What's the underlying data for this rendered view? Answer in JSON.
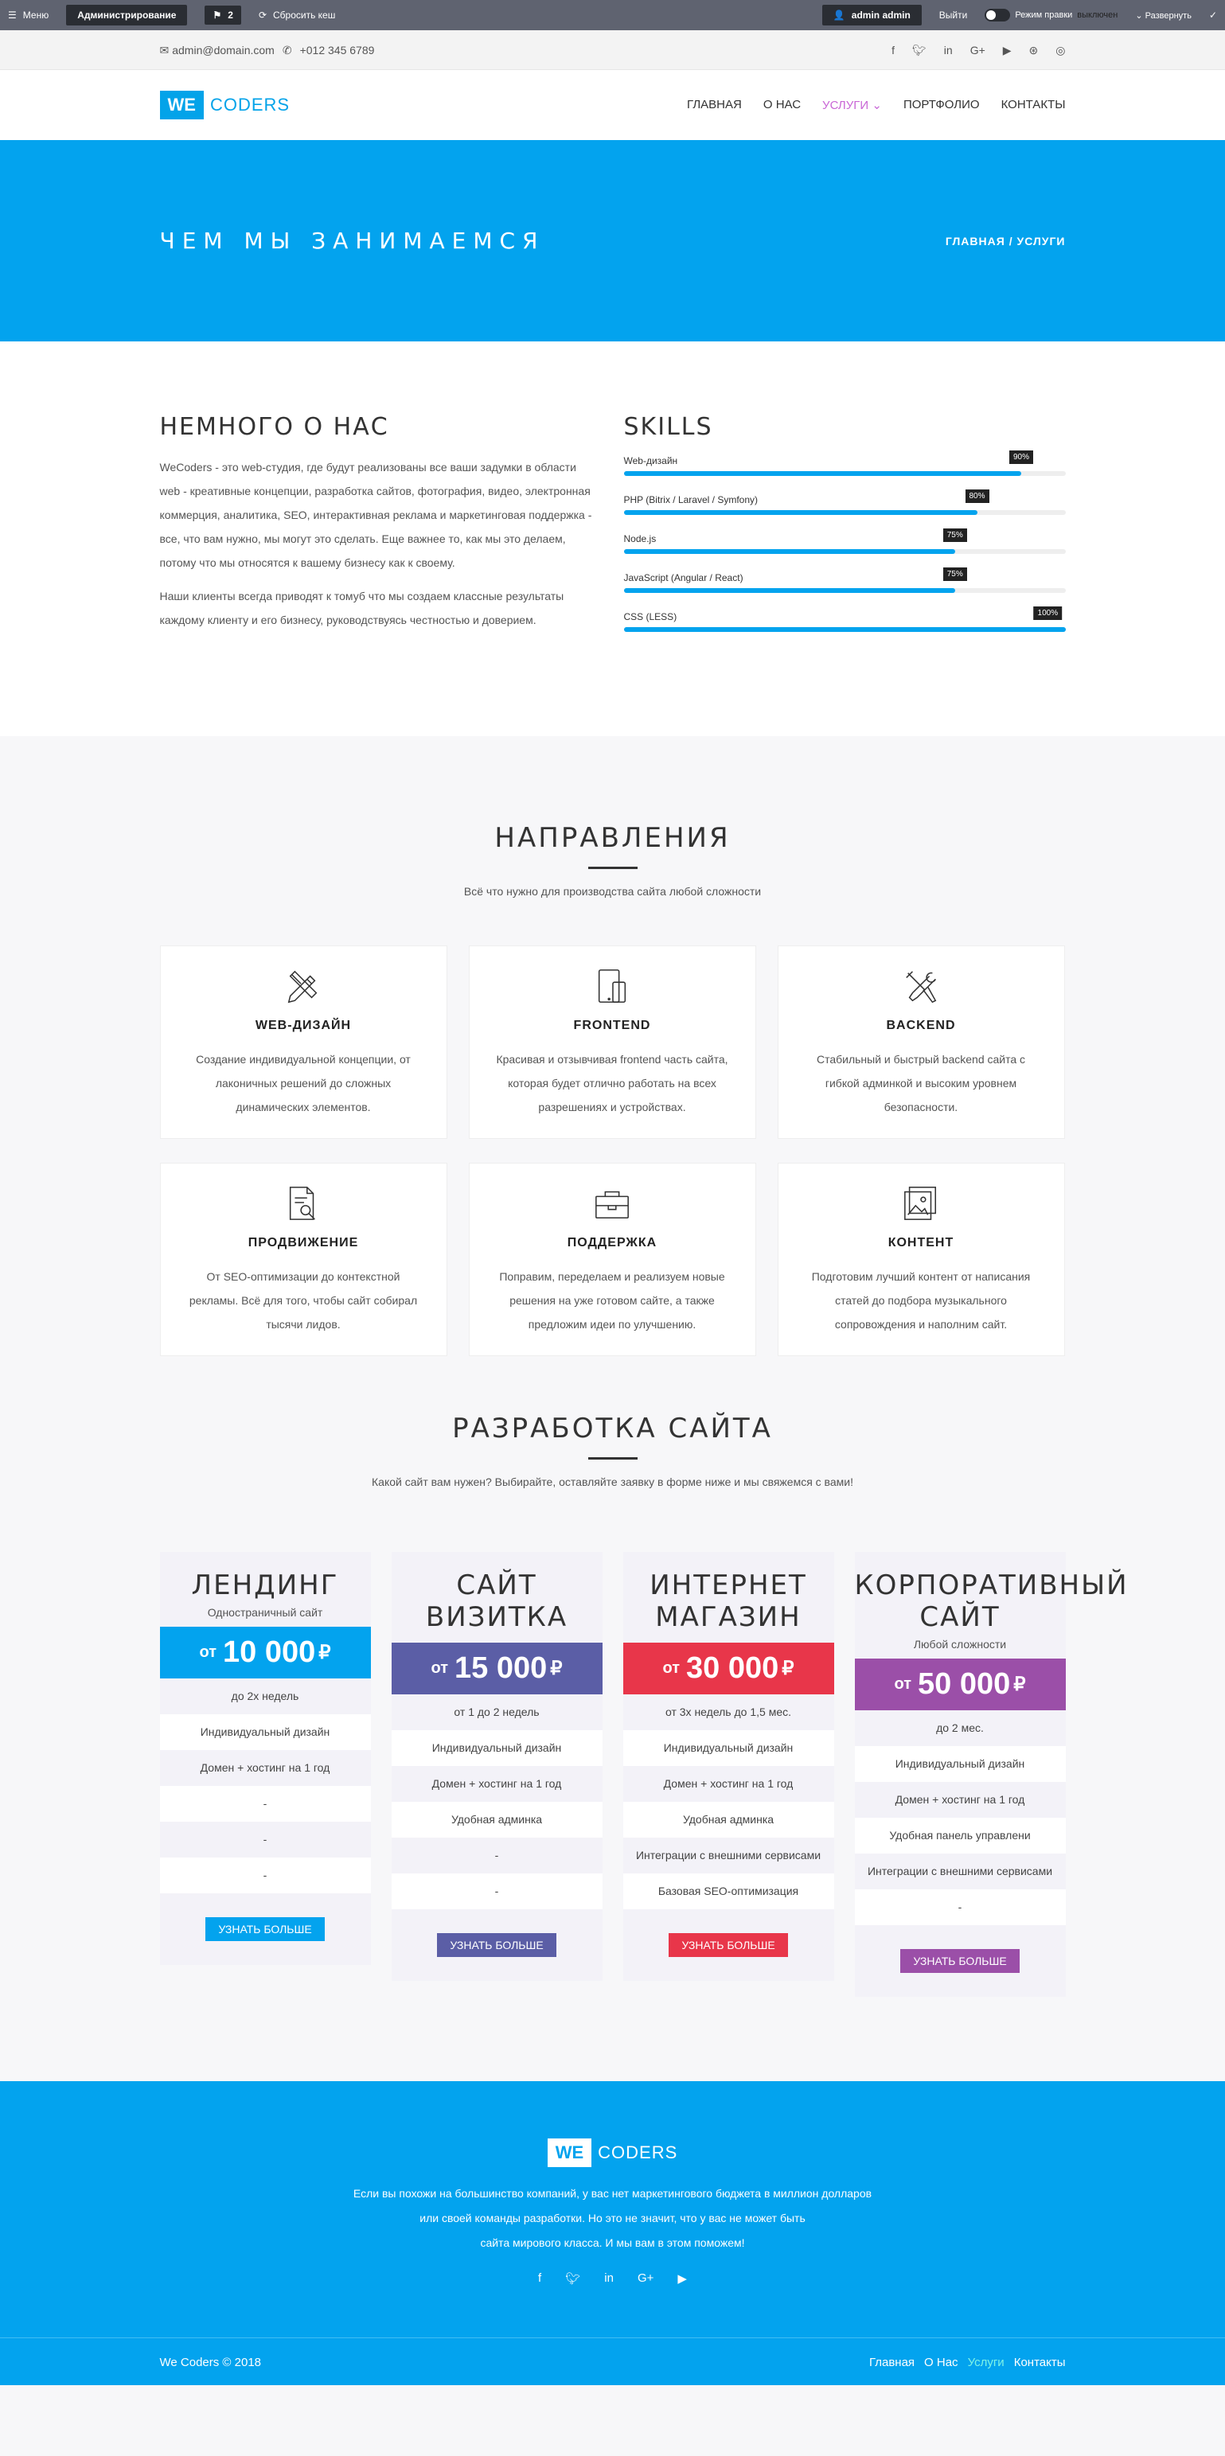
{
  "adminbar": {
    "menu": "Меню",
    "admin": "Администрирование",
    "count": "2",
    "reset": "Сбросить кеш",
    "user": "admin admin",
    "logout": "Выйти",
    "edit_mode": "Режим правки",
    "edit_state": "выключен",
    "expand": "Развернуть"
  },
  "topbar": {
    "email": "admin@domain.com",
    "phone": "+012 345 6789"
  },
  "logo": {
    "we": "WE",
    "coders": "CODERS"
  },
  "nav": [
    "ГЛАВНАЯ",
    "О НАС",
    "УСЛУГИ",
    "ПОРТФОЛИО",
    "КОНТАКТЫ"
  ],
  "hero": {
    "title": "ЧЕМ МЫ ЗАНИМАЕМСЯ",
    "crumb_home": "ГЛАВНАЯ",
    "crumb_current": "УСЛУГИ"
  },
  "about": {
    "title": "НЕМНОГО О НАС",
    "p1": "WeCoders - это web-студия, где будут реализованы все ваши задумки в области web - креативные концепции, разработка сайтов, фотография, видео, электронная коммерция, аналитика, SEO, интерактивная реклама и маркетинговая поддержка - все, что вам нужно, мы могут это сделать. Еще важнее то, как мы это делаем, потому что мы относятся к вашему бизнесу как к своему.",
    "p2": "Наши клиенты всегда приводят к томуб что мы создаем классные результаты каждому клиенту и его бизнесу, руководствуясь честностью и доверием."
  },
  "skills": {
    "title": "SKILLS",
    "items": [
      {
        "name": "Web-дизайн",
        "value": 90,
        "label": "90%"
      },
      {
        "name": "PHP (Bitrix / Laravel / Symfony)",
        "value": 80,
        "label": "80%"
      },
      {
        "name": "Node.js",
        "value": 75,
        "label": "75%"
      },
      {
        "name": "JavaScript (Angular / React)",
        "value": 75,
        "label": "75%"
      },
      {
        "name": "CSS (LESS)",
        "value": 100,
        "label": "100%"
      }
    ]
  },
  "directions": {
    "title": "НАПРАВЛЕНИЯ",
    "subtitle": "Всё что нужно для производства сайта любой сложности",
    "cards": [
      {
        "icon": "pencil-ruler-icon",
        "title": "WEB-ДИЗАЙН",
        "text": "Создание индивидуальной концепции, от лаконичных решений до сложных динамических элементов."
      },
      {
        "icon": "devices-icon",
        "title": "FRONTEND",
        "text": "Красивая и отзывчивая frontend часть сайта, которая будет отлично работать на всех разрешениях и устройствах."
      },
      {
        "icon": "tools-icon",
        "title": "BACKEND",
        "text": "Стабильный и быстрый backend сайта с гибкой админкой и высоким уровнем безопасности."
      },
      {
        "icon": "document-search-icon",
        "title": "ПРОДВИЖЕНИЕ",
        "text": "От SEO-оптимизации до контекстной рекламы. Всё для того, чтобы сайт собирал тысячи лидов."
      },
      {
        "icon": "toolbox-icon",
        "title": "ПОДДЕРЖКА",
        "text": "Поправим, переделаем и реализуем новые решения на уже готовом сайте, а также предложим идеи по улучшению."
      },
      {
        "icon": "gallery-icon",
        "title": "КОНТЕНТ",
        "text": "Подготовим лучший контент от написания статей до подбора музыкального сопровождения и наполним сайт."
      }
    ]
  },
  "pricing": {
    "title": "РАЗРАБОТКА САЙТА",
    "subtitle": "Какой сайт вам нужен? Выбирайте, оставляйте заявку в форме ниже и мы свяжемся с вами!",
    "from": "от",
    "currency": "₽",
    "plans": [
      {
        "title": "ЛЕНДИНГ",
        "sub": "Одностраничный сайт",
        "price": "10 000",
        "color": "#03a3ee",
        "features": [
          "до 2х недель",
          "Индивидуальный дизайн",
          "Домен + хостинг на 1 год",
          "-",
          "-",
          "-"
        ],
        "button": "УЗНАТЬ БОЛЬШЕ"
      },
      {
        "title": "САЙТ ВИЗИТКА",
        "sub": "",
        "price": "15 000",
        "color": "#5b5ea6",
        "features": [
          "от 1 до 2 недель",
          "Индивидуальный дизайн",
          "Домен + хостинг на 1 год",
          "Удобная админка",
          "-",
          "-"
        ],
        "button": "УЗНАТЬ БОЛЬШЕ"
      },
      {
        "title": "ИНТЕРНЕТ МАГАЗИН",
        "sub": "",
        "price": "30 000",
        "color": "#e8364a",
        "features": [
          "от 3х недель до 1,5 мес.",
          "Индивидуальный дизайн",
          "Домен + хостинг на 1 год",
          "Удобная админка",
          "Интеграции с внешними сервисами",
          "Базовая SEO-оптимизация"
        ],
        "button": "УЗНАТЬ БОЛЬШЕ"
      },
      {
        "title": "КОРПОРАТИВНЫЙ САЙТ",
        "sub": "Любой сложности",
        "price": "50 000",
        "color": "#9b4fa8",
        "features": [
          "до 2 мес.",
          "Индивидуальный дизайн",
          "Домен + хостинг на 1 год",
          "Удобная панель управлени",
          "Интеграции с внешними сервисами",
          "-"
        ],
        "button": "УЗНАТЬ БОЛЬШЕ"
      }
    ]
  },
  "footer": {
    "text1": "Если вы похожи на большинство компаний, у вас нет маркетингового бюджета в миллион долларов",
    "text2": "или своей команды разработки. Но это не значит, что у вас не может быть",
    "text3": "сайта мирового класса. И мы вам в этом поможем!",
    "copyright": "We Coders © 2018",
    "links": [
      "Главная",
      "О Нас",
      "Услуги",
      "Контакты"
    ]
  }
}
